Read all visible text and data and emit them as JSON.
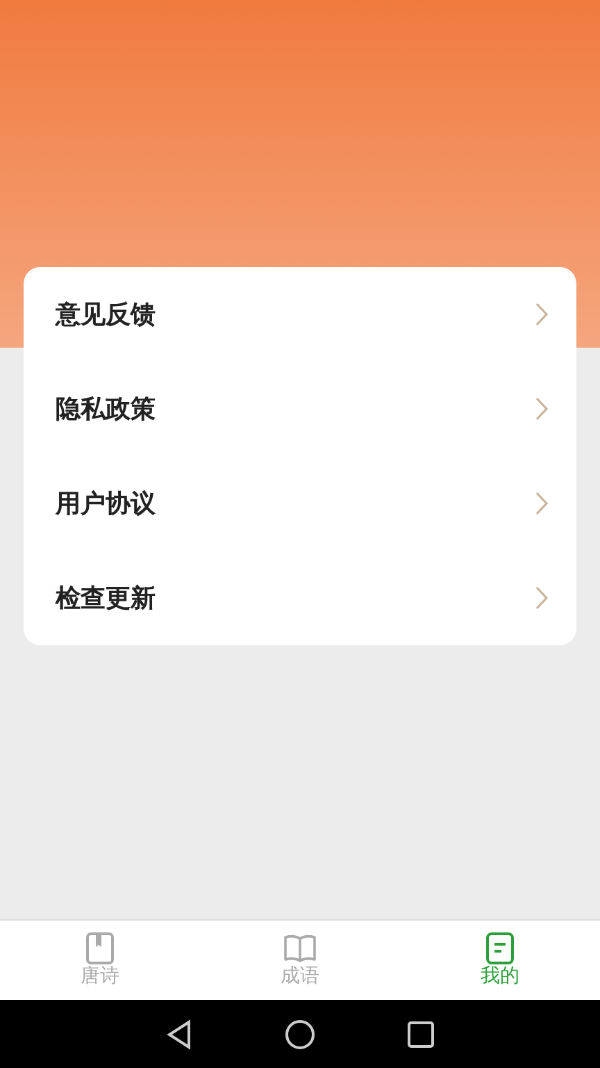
{
  "menu": [
    {
      "label": "意见反馈"
    },
    {
      "label": "隐私政策"
    },
    {
      "label": "用户协议"
    },
    {
      "label": "检查更新"
    }
  ],
  "tabs": [
    {
      "label": "唐诗",
      "kind": "book",
      "selected": false
    },
    {
      "label": "成语",
      "kind": "open-book",
      "selected": false
    },
    {
      "label": "我的",
      "kind": "document",
      "selected": true
    }
  ]
}
